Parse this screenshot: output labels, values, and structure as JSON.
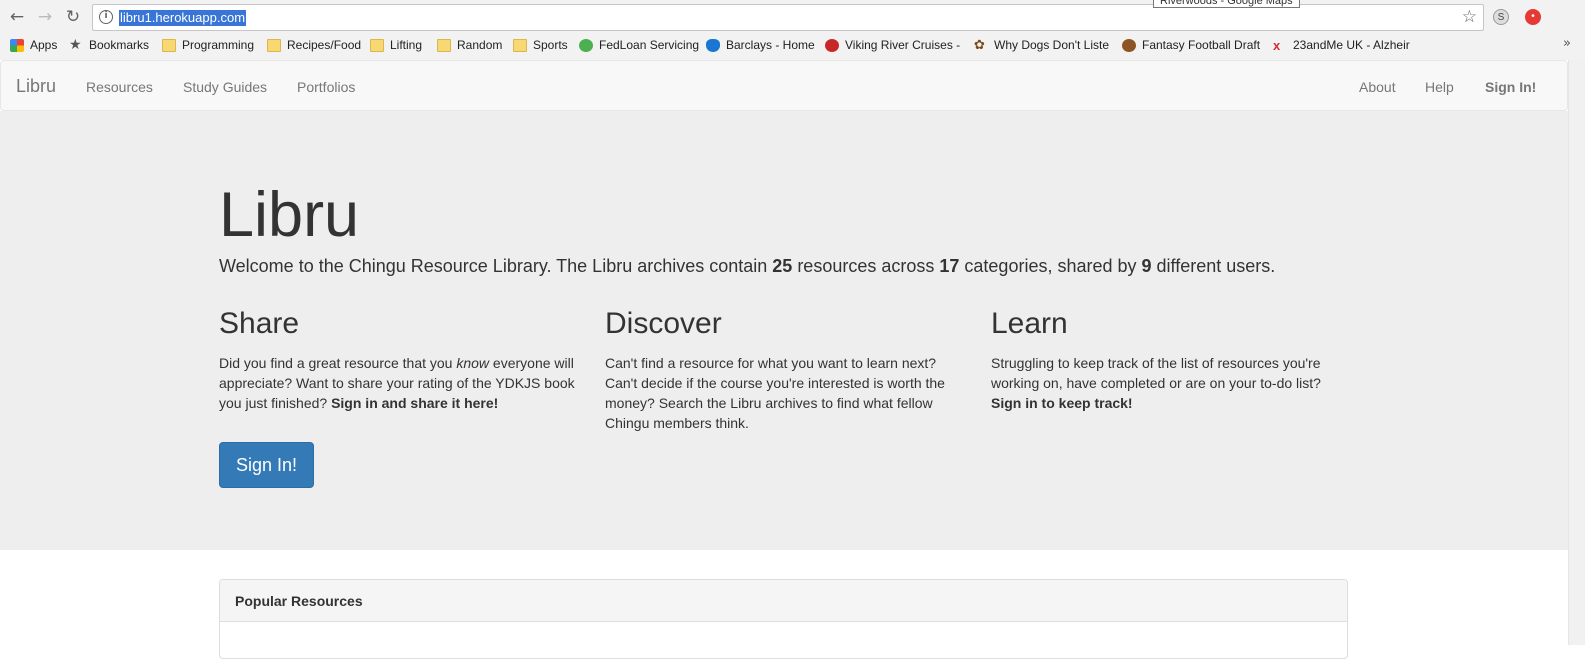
{
  "browser": {
    "url": "libru1.herokuapp.com",
    "tooltip": "Riverwoods - Google Maps",
    "back_icon": "←",
    "forward_icon": "→",
    "reload_icon": "↻",
    "info_icon": "i",
    "star_icon": "☆",
    "ext_s_label": "S",
    "ext_r_label": "•",
    "more_icon": "»"
  },
  "bookmarks": [
    {
      "label": "Apps",
      "icon": "apps-grid-icon"
    },
    {
      "label": "Bookmarks",
      "icon": "star-icon"
    },
    {
      "label": "Programming",
      "icon": "folder-icon"
    },
    {
      "label": "Recipes/Food",
      "icon": "folder-icon"
    },
    {
      "label": "Lifting",
      "icon": "folder-icon"
    },
    {
      "label": "Random",
      "icon": "folder-icon"
    },
    {
      "label": "Sports",
      "icon": "folder-icon"
    },
    {
      "label": "FedLoan Servicing",
      "icon": "fedloan-icon"
    },
    {
      "label": "Barclays - Home",
      "icon": "barclays-icon"
    },
    {
      "label": "Viking River Cruises -",
      "icon": "viking-icon"
    },
    {
      "label": "Why Dogs Don't Liste",
      "icon": "paw-icon"
    },
    {
      "label": "Fantasy Football Draft",
      "icon": "football-icon"
    },
    {
      "label": "23andMe UK - Alzheir",
      "icon": "23andme-icon"
    }
  ],
  "navbar": {
    "brand": "Libru",
    "links": [
      "Resources",
      "Study Guides",
      "Portfolios"
    ],
    "right_links": [
      "About",
      "Help",
      "Sign In!"
    ]
  },
  "hero": {
    "title": "Libru",
    "welcome_prefix": "Welcome to the Chingu Resource Library. The Libru archives contain ",
    "resource_count": "25",
    "welcome_mid1": " resources across ",
    "category_count": "17",
    "welcome_mid2": " categories, shared by ",
    "user_count": "9",
    "welcome_suffix": " different users.",
    "share": {
      "heading": "Share",
      "text_a": "Did you find a great resource that you ",
      "text_em": "know",
      "text_b": " everyone will appreciate? Want to share your rating of the YDKJS book you just finished? ",
      "text_strong": "Sign in and share it here!"
    },
    "discover": {
      "heading": "Discover",
      "text": "Can't find a resource for what you want to learn next? Can't decide if the course you're interested is worth the money? Search the Libru archives to find what fellow Chingu members think."
    },
    "learn": {
      "heading": "Learn",
      "text_a": "Struggling to keep track of the list of resources you're working on, have completed or are on your to-do list? ",
      "text_strong": "Sign in to keep track!"
    },
    "signin_button": "Sign In!"
  },
  "popular": {
    "heading": "Popular Resources"
  }
}
